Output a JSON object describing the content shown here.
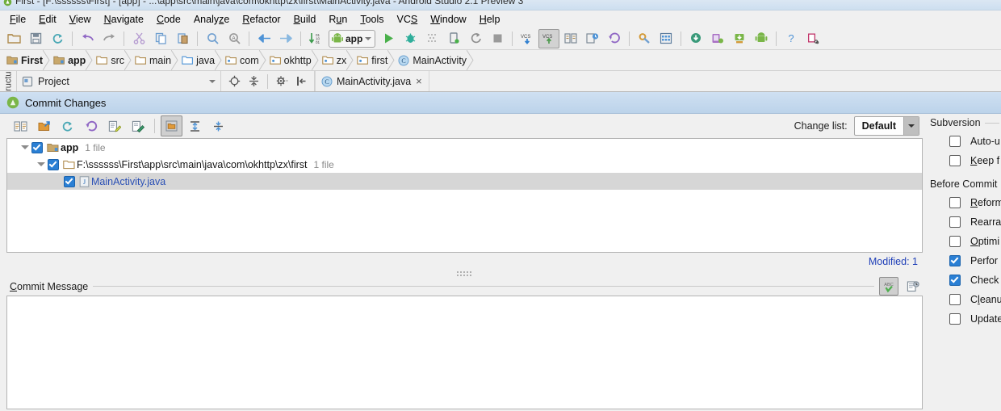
{
  "window": {
    "title": "First - [F:\\ssssss\\First] - [app] - ...\\app\\src\\main\\java\\com\\okhttp\\zx\\first\\MainActivity.java - Android Studio 2.1 Preview 3",
    "app_icon": "android-studio-icon"
  },
  "menubar": {
    "items": [
      {
        "label": "File",
        "mnemonic": "F"
      },
      {
        "label": "Edit",
        "mnemonic": "E"
      },
      {
        "label": "View",
        "mnemonic": "V"
      },
      {
        "label": "Navigate",
        "mnemonic": "N"
      },
      {
        "label": "Code",
        "mnemonic": "C"
      },
      {
        "label": "Analyze",
        "mnemonic": "z"
      },
      {
        "label": "Refactor",
        "mnemonic": "R"
      },
      {
        "label": "Build",
        "mnemonic": "B"
      },
      {
        "label": "Run",
        "mnemonic": "u"
      },
      {
        "label": "Tools",
        "mnemonic": "T"
      },
      {
        "label": "VCS",
        "mnemonic": "S"
      },
      {
        "label": "Window",
        "mnemonic": "W"
      },
      {
        "label": "Help",
        "mnemonic": "H"
      }
    ]
  },
  "toolbar": {
    "run_config_label": "app",
    "buttons": [
      "open-folder-icon",
      "save-all-icon",
      "sync-refresh-icon",
      "undo-icon",
      "redo-icon",
      "cut-icon",
      "copy-icon",
      "paste-icon",
      "find-icon",
      "replace-icon",
      "back-icon",
      "forward-icon",
      "sort-numeric-icon",
      "run-icon",
      "debug-icon",
      "coverage-icon",
      "attach-debugger-icon",
      "rerun-icon",
      "stop-icon",
      "vcs-update-icon",
      "vcs-commit-icon",
      "vcs-compare-icon",
      "vcs-history-icon",
      "vcs-rollback-icon",
      "settings-icon",
      "project-structure-icon",
      "sdk-download-icon",
      "avd-manager-icon",
      "sdk-manager-icon",
      "android-monitor-icon",
      "help-icon",
      "layout-inspector-icon"
    ]
  },
  "breadcrumb": {
    "items": [
      {
        "label": "First",
        "icon": "module-folder-icon",
        "bold": true
      },
      {
        "label": "app",
        "icon": "module-folder-icon",
        "bold": true
      },
      {
        "label": "src",
        "icon": "folder-icon",
        "bold": false
      },
      {
        "label": "main",
        "icon": "folder-icon",
        "bold": false
      },
      {
        "label": "java",
        "icon": "source-folder-icon",
        "bold": false
      },
      {
        "label": "com",
        "icon": "package-folder-icon",
        "bold": false
      },
      {
        "label": "okhttp",
        "icon": "package-folder-icon",
        "bold": false
      },
      {
        "label": "zx",
        "icon": "package-folder-icon",
        "bold": false
      },
      {
        "label": "first",
        "icon": "package-folder-icon",
        "bold": false
      },
      {
        "label": "MainActivity",
        "icon": "class-icon",
        "bold": false
      }
    ]
  },
  "tool_strip": {
    "structure_label": "Structure"
  },
  "project_panel": {
    "title": "Project",
    "tools": [
      "locate-icon",
      "collapse-all-icon",
      "settings-gear-icon",
      "hide-panel-icon"
    ]
  },
  "editor_tabs": [
    {
      "label": "MainActivity.java",
      "icon": "class-icon",
      "close": "×",
      "active": true
    }
  ],
  "commit_dialog": {
    "header_title": "Commit Changes",
    "header_icon": "android-icon",
    "toolbar_buttons": [
      "show-diff-icon",
      "move-to-changelist-icon",
      "refresh-icon",
      "rollback-icon",
      "edit-source-icon",
      "revert-icon",
      "group-by-directory-icon",
      "expand-all-icon",
      "collapse-all-icon"
    ],
    "change_list_label": "Change list:",
    "change_list_value": "Default",
    "tree": [
      {
        "label": "app",
        "count": "1 file",
        "icon": "module-folder-icon",
        "checked": true,
        "expanded": true,
        "depth": 0,
        "bold": true,
        "link": false,
        "selected": false
      },
      {
        "label": "F:\\ssssss\\First\\app\\src\\main\\java\\com\\okhttp\\zx\\first",
        "count": "1 file",
        "icon": "folder-icon",
        "checked": true,
        "expanded": true,
        "depth": 1,
        "bold": false,
        "link": false,
        "selected": false
      },
      {
        "label": "MainActivity.java",
        "count": "",
        "icon": "java-file-icon",
        "checked": true,
        "expanded": null,
        "depth": 2,
        "bold": false,
        "link": true,
        "selected": true
      }
    ],
    "status": "Modified: 1",
    "message_label": "Commit Message",
    "message_value": "",
    "message_tools": [
      "spellcheck-abc-icon",
      "message-history-icon"
    ]
  },
  "options_panel": {
    "groups": [
      {
        "title": "Subversion",
        "options": [
          {
            "label": "Auto-u",
            "mnemonic": "",
            "checked": false
          },
          {
            "label": "Keep f",
            "mnemonic": "K",
            "checked": false
          }
        ]
      },
      {
        "title": "Before Commit",
        "options": [
          {
            "label": "Reform",
            "mnemonic": "R",
            "checked": false
          },
          {
            "label": "Rearra",
            "mnemonic": "",
            "checked": false
          },
          {
            "label": "Optimi",
            "mnemonic": "O",
            "checked": false
          },
          {
            "label": "Perfor",
            "mnemonic": "",
            "checked": true
          },
          {
            "label": "Check",
            "mnemonic": "",
            "checked": true
          },
          {
            "label": "Cleanu",
            "mnemonic": "l",
            "checked": false
          },
          {
            "label": "Update",
            "mnemonic": "",
            "checked": false
          }
        ]
      }
    ]
  },
  "colors": {
    "accent_blue": "#2a7fd4",
    "link_blue": "#2b50b5",
    "status_blue": "#2040b8",
    "header_gradient_top": "#cfe0f2",
    "header_gradient_bottom": "#bcd3ea",
    "panel_bg": "#f0f0f0",
    "selection_gray": "#d6d6d6"
  }
}
